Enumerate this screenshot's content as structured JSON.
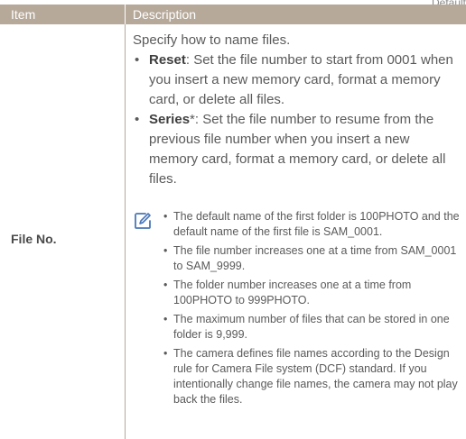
{
  "corner_label": "Default",
  "table": {
    "header": {
      "item": "Item",
      "description": "Description"
    },
    "row": {
      "item": "File No.",
      "intro": "Specify how to name files.",
      "bullets": [
        {
          "term": "Reset",
          "suffix": "",
          "text": ": Set the file number to start from 0001 when you insert a new memory card, format a memory card, or delete all files."
        },
        {
          "term": "Series",
          "suffix": "*",
          "text": ": Set the file number to resume from the previous file number when you insert a new memory card, format a memory card, or delete all files."
        }
      ],
      "note": {
        "icon": "note-pencil-icon",
        "items": [
          "The default name of the first folder is 100PHOTO and the default name of the first file is SAM_0001.",
          "The file number increases one at a time from SAM_0001 to SAM_9999.",
          "The folder number increases one at a time from 100PHOTO to 999PHOTO.",
          "The maximum number of files that can be stored in one folder is 9,999.",
          "The camera defines file names according to the Design rule for Camera File system (DCF) standard. If you intentionally change file names, the camera may not play back the files."
        ]
      }
    }
  },
  "colors": {
    "header_bg": "#b6a99a",
    "header_text": "#ffffff",
    "body_text": "#5a5a5a",
    "icon": "#4a76b8"
  }
}
